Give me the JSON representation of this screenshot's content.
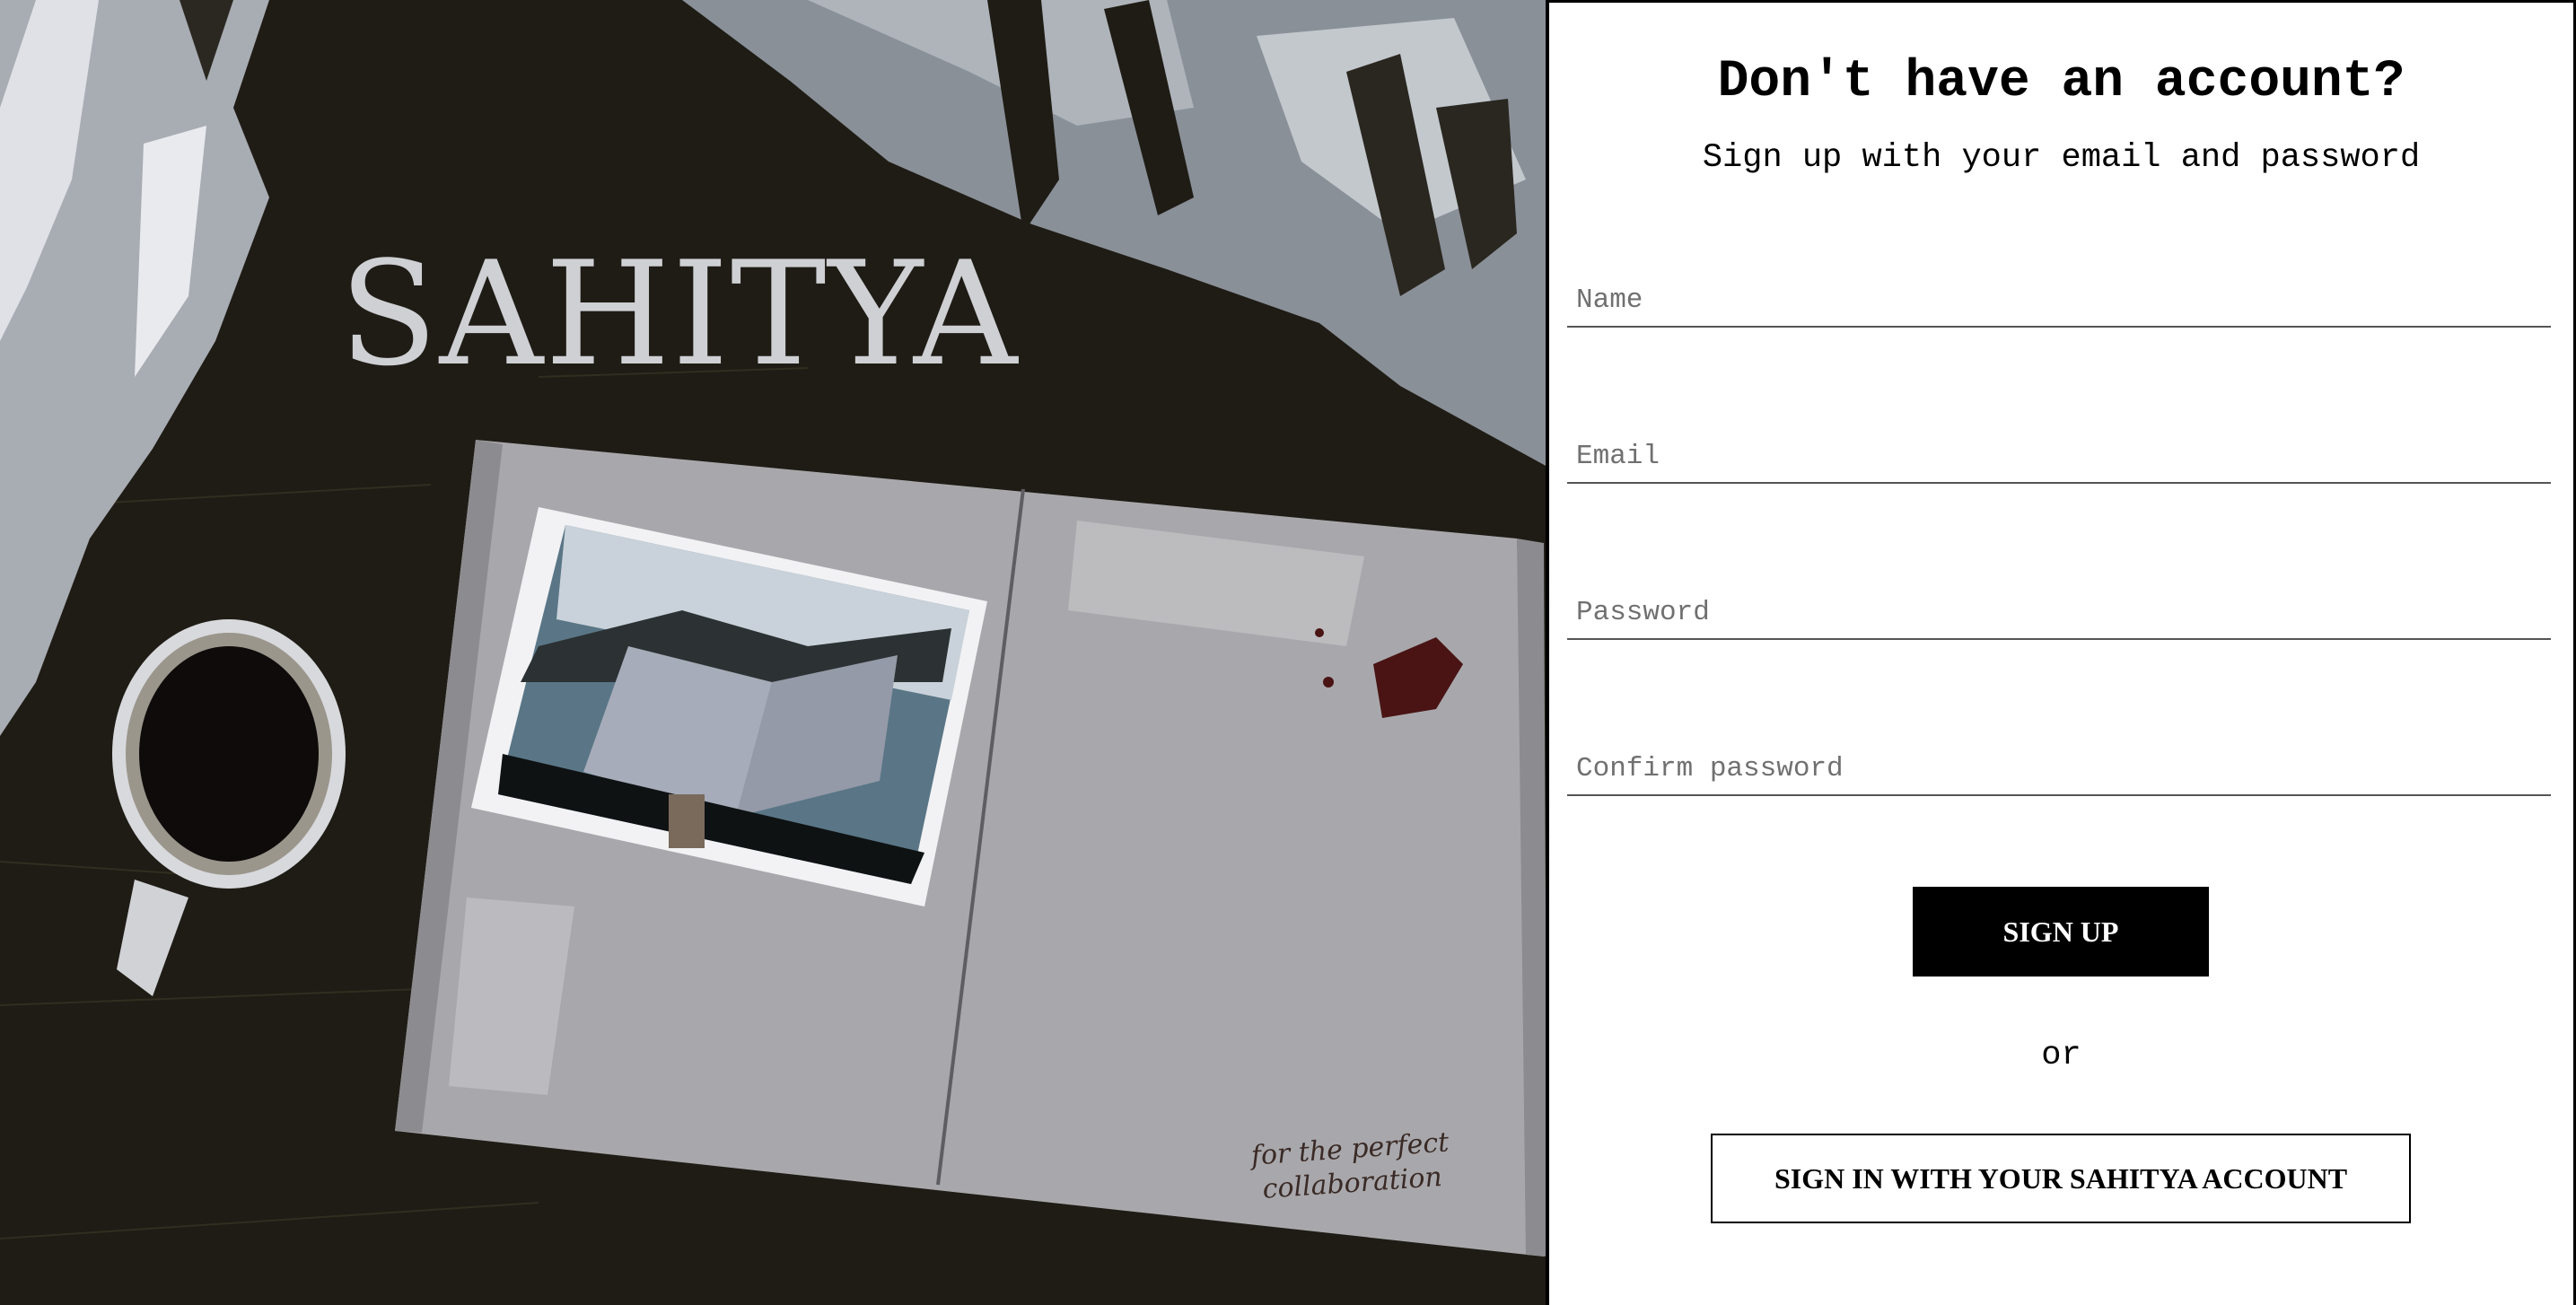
{
  "artwork": {
    "brand_text": "SAHITYA",
    "tagline_line1": "for the perfect",
    "tagline_line2": "collaboration"
  },
  "signup": {
    "title": "Don't have an account?",
    "subtitle": "Sign up with your email and password",
    "fields": {
      "name": {
        "placeholder": "Name",
        "value": ""
      },
      "email": {
        "placeholder": "Email",
        "value": ""
      },
      "password": {
        "placeholder": "Password",
        "value": ""
      },
      "confirm_password": {
        "placeholder": "Confirm password",
        "value": ""
      }
    },
    "signup_button": "SIGN UP",
    "or_text": "or",
    "sahitya_signin_button": "SIGN IN WITH YOUR SAHITYA ACCOUNT"
  },
  "colors": {
    "background_dark": "#1f1c15",
    "book_page": "#a8a8ac",
    "button_primary": "#000000",
    "button_text": "#ffffff"
  }
}
